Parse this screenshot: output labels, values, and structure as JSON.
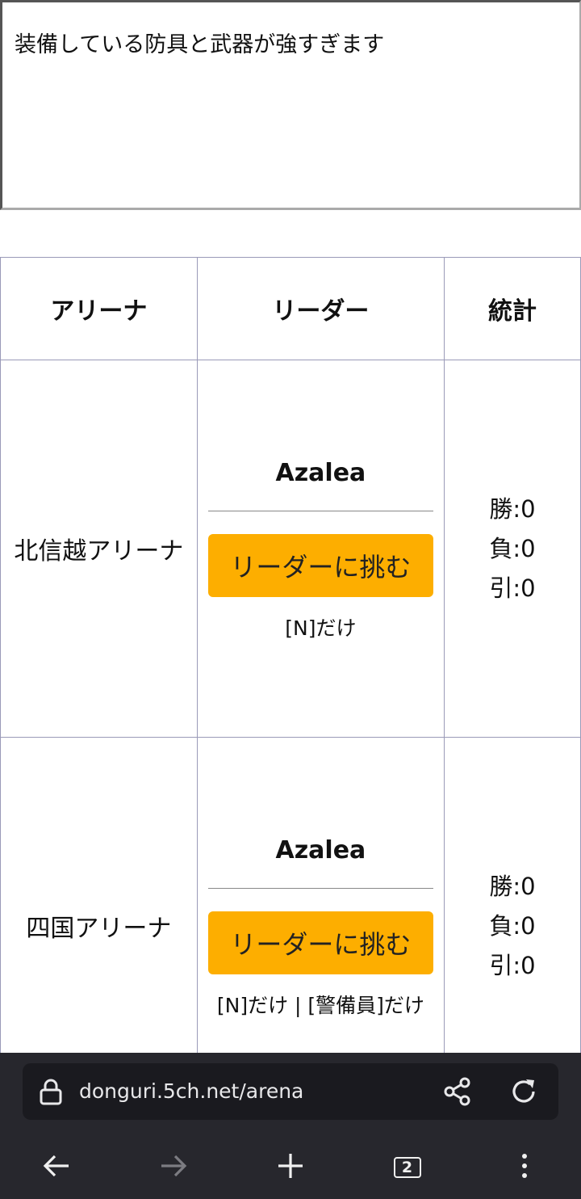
{
  "message_box": {
    "text": "装備している防具と武器が強すぎます"
  },
  "table": {
    "headers": [
      "アリーナ",
      "リーダー",
      "統計"
    ],
    "rows": [
      {
        "arena": "北信越アリーナ",
        "leader": "Azalea",
        "button_label": "リーダーに挑む",
        "restriction": "[N]だけ",
        "stats": {
          "win": "勝:0",
          "loss": "負:0",
          "draw": "引:0"
        }
      },
      {
        "arena": "四国アリーナ",
        "leader": "Azalea",
        "button_label": "リーダーに挑む",
        "restriction": "[N]だけ | [警備員]だけ",
        "stats": {
          "win": "勝:0",
          "loss": "負:0",
          "draw": "引:0"
        }
      }
    ]
  },
  "browser": {
    "url": "donguri.5ch.net/arena",
    "tab_count": "2",
    "icons": [
      "lock-icon",
      "share-icon",
      "reload-icon",
      "back-icon",
      "forward-icon",
      "new-tab-icon",
      "tabs-icon",
      "menu-icon"
    ]
  },
  "colors": {
    "button": "#fdae00",
    "browser_bar": "#27272d",
    "url_field": "#1a1a1f",
    "table_border": "#9a9ab8"
  }
}
